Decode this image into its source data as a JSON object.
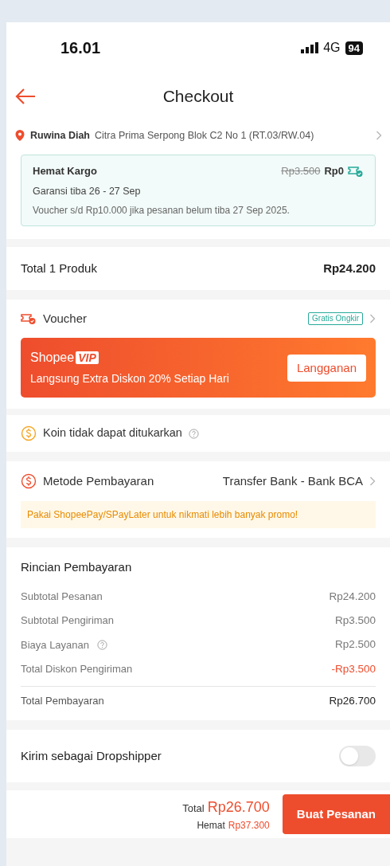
{
  "status_bar": {
    "time": "16.01",
    "network": "4G",
    "battery": "94"
  },
  "header": {
    "title": "Checkout"
  },
  "address": {
    "name": "Ruwina Diah",
    "line": "Citra Prima Serpong Blok C2 No 1 (RT.03/RW.04)"
  },
  "shipping": {
    "name": "Hemat Kargo",
    "old_price": "Rp3.500",
    "price": "Rp0",
    "guarantee": "Garansi tiba 26 - 27 Sep",
    "note": "Voucher s/d  Rp10.000 jika pesanan belum tiba 27 Sep 2025."
  },
  "product_total": {
    "label": "Total 1 Produk",
    "value": "Rp24.200"
  },
  "voucher": {
    "label": "Voucher",
    "tag": "Gratis Ongkir"
  },
  "vip_banner": {
    "brand": "Shopee",
    "badge": "VIP",
    "text": "Langsung Extra Diskon 20% Setiap Hari",
    "button": "Langganan"
  },
  "coins": {
    "label": "Koin tidak dapat ditukarkan"
  },
  "payment_method": {
    "label": "Metode Pembayaran",
    "value": "Transfer Bank - Bank BCA",
    "promo": "Pakai ShopeePay/SPayLater untuk nikmati lebih banyak promo!"
  },
  "payment_details": {
    "title": "Rincian Pembayaran",
    "rows": [
      {
        "kind": "normal",
        "label": "Subtotal Pesanan",
        "value": "Rp24.200",
        "help": false
      },
      {
        "kind": "normal",
        "label": "Subtotal Pengiriman",
        "value": "Rp3.500",
        "help": false
      },
      {
        "kind": "normal",
        "label": "Biaya Layanan",
        "value": "Rp2.500",
        "help": true
      },
      {
        "kind": "discount",
        "label": "Total Diskon Pengiriman",
        "value": "-Rp3.500",
        "help": false
      },
      {
        "kind": "total",
        "label": "Total Pembayaran",
        "value": "Rp26.700",
        "help": false
      }
    ]
  },
  "dropshipper": {
    "label": "Kirim sebagai Dropshipper",
    "on": false
  },
  "footer": {
    "total_label": "Total",
    "total": "Rp26.700",
    "savings_label": "Hemat",
    "savings": "Rp37.300",
    "button": "Buat Pesanan"
  }
}
